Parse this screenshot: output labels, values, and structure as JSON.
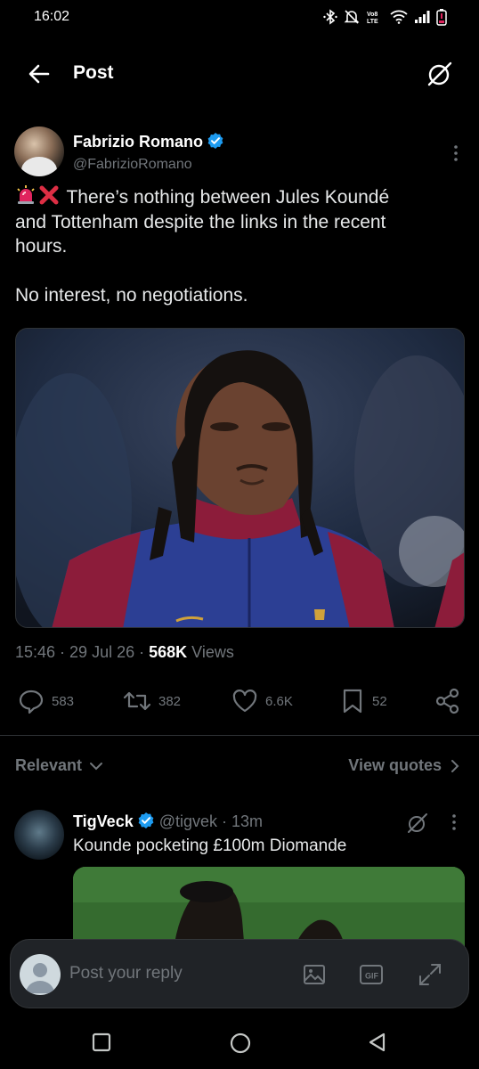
{
  "status_bar": {
    "time": "16:02",
    "icons": [
      "bluetooth-icon",
      "mute-icon",
      "volte-icon",
      "wifi-icon",
      "signal-icon",
      "battery-low-icon"
    ]
  },
  "header": {
    "title": "Post",
    "back_icon": "arrow-left-icon",
    "grok_icon": "grok-icon"
  },
  "post": {
    "author_name": "Fabrizio Romano",
    "author_handle": "@FabrizioRomano",
    "text_line1": "There’s nothing between Jules Koundé",
    "text_line2": "and Tottenham despite the links in the recent",
    "text_line3": "hours.",
    "text_para2": "No interest, no negotiations.",
    "time": "15:46",
    "date": "29 Jul 26",
    "views_count": "568K",
    "views_label": "Views",
    "replies": "583",
    "reposts": "382",
    "likes": "6.6K",
    "bookmarks": "52"
  },
  "sort": {
    "relevant_label": "Relevant",
    "view_quotes_label": "View quotes"
  },
  "reply": {
    "name": "TigVeck",
    "handle": "@tigvek",
    "age": "13m",
    "text": "Kounde pocketing £100m Diomande"
  },
  "composer": {
    "placeholder": "Post your reply"
  },
  "colors": {
    "background": "#000000",
    "secondary_text": "#71767b",
    "verified_blue": "#1d9bf0",
    "divider": "#2f3336"
  }
}
